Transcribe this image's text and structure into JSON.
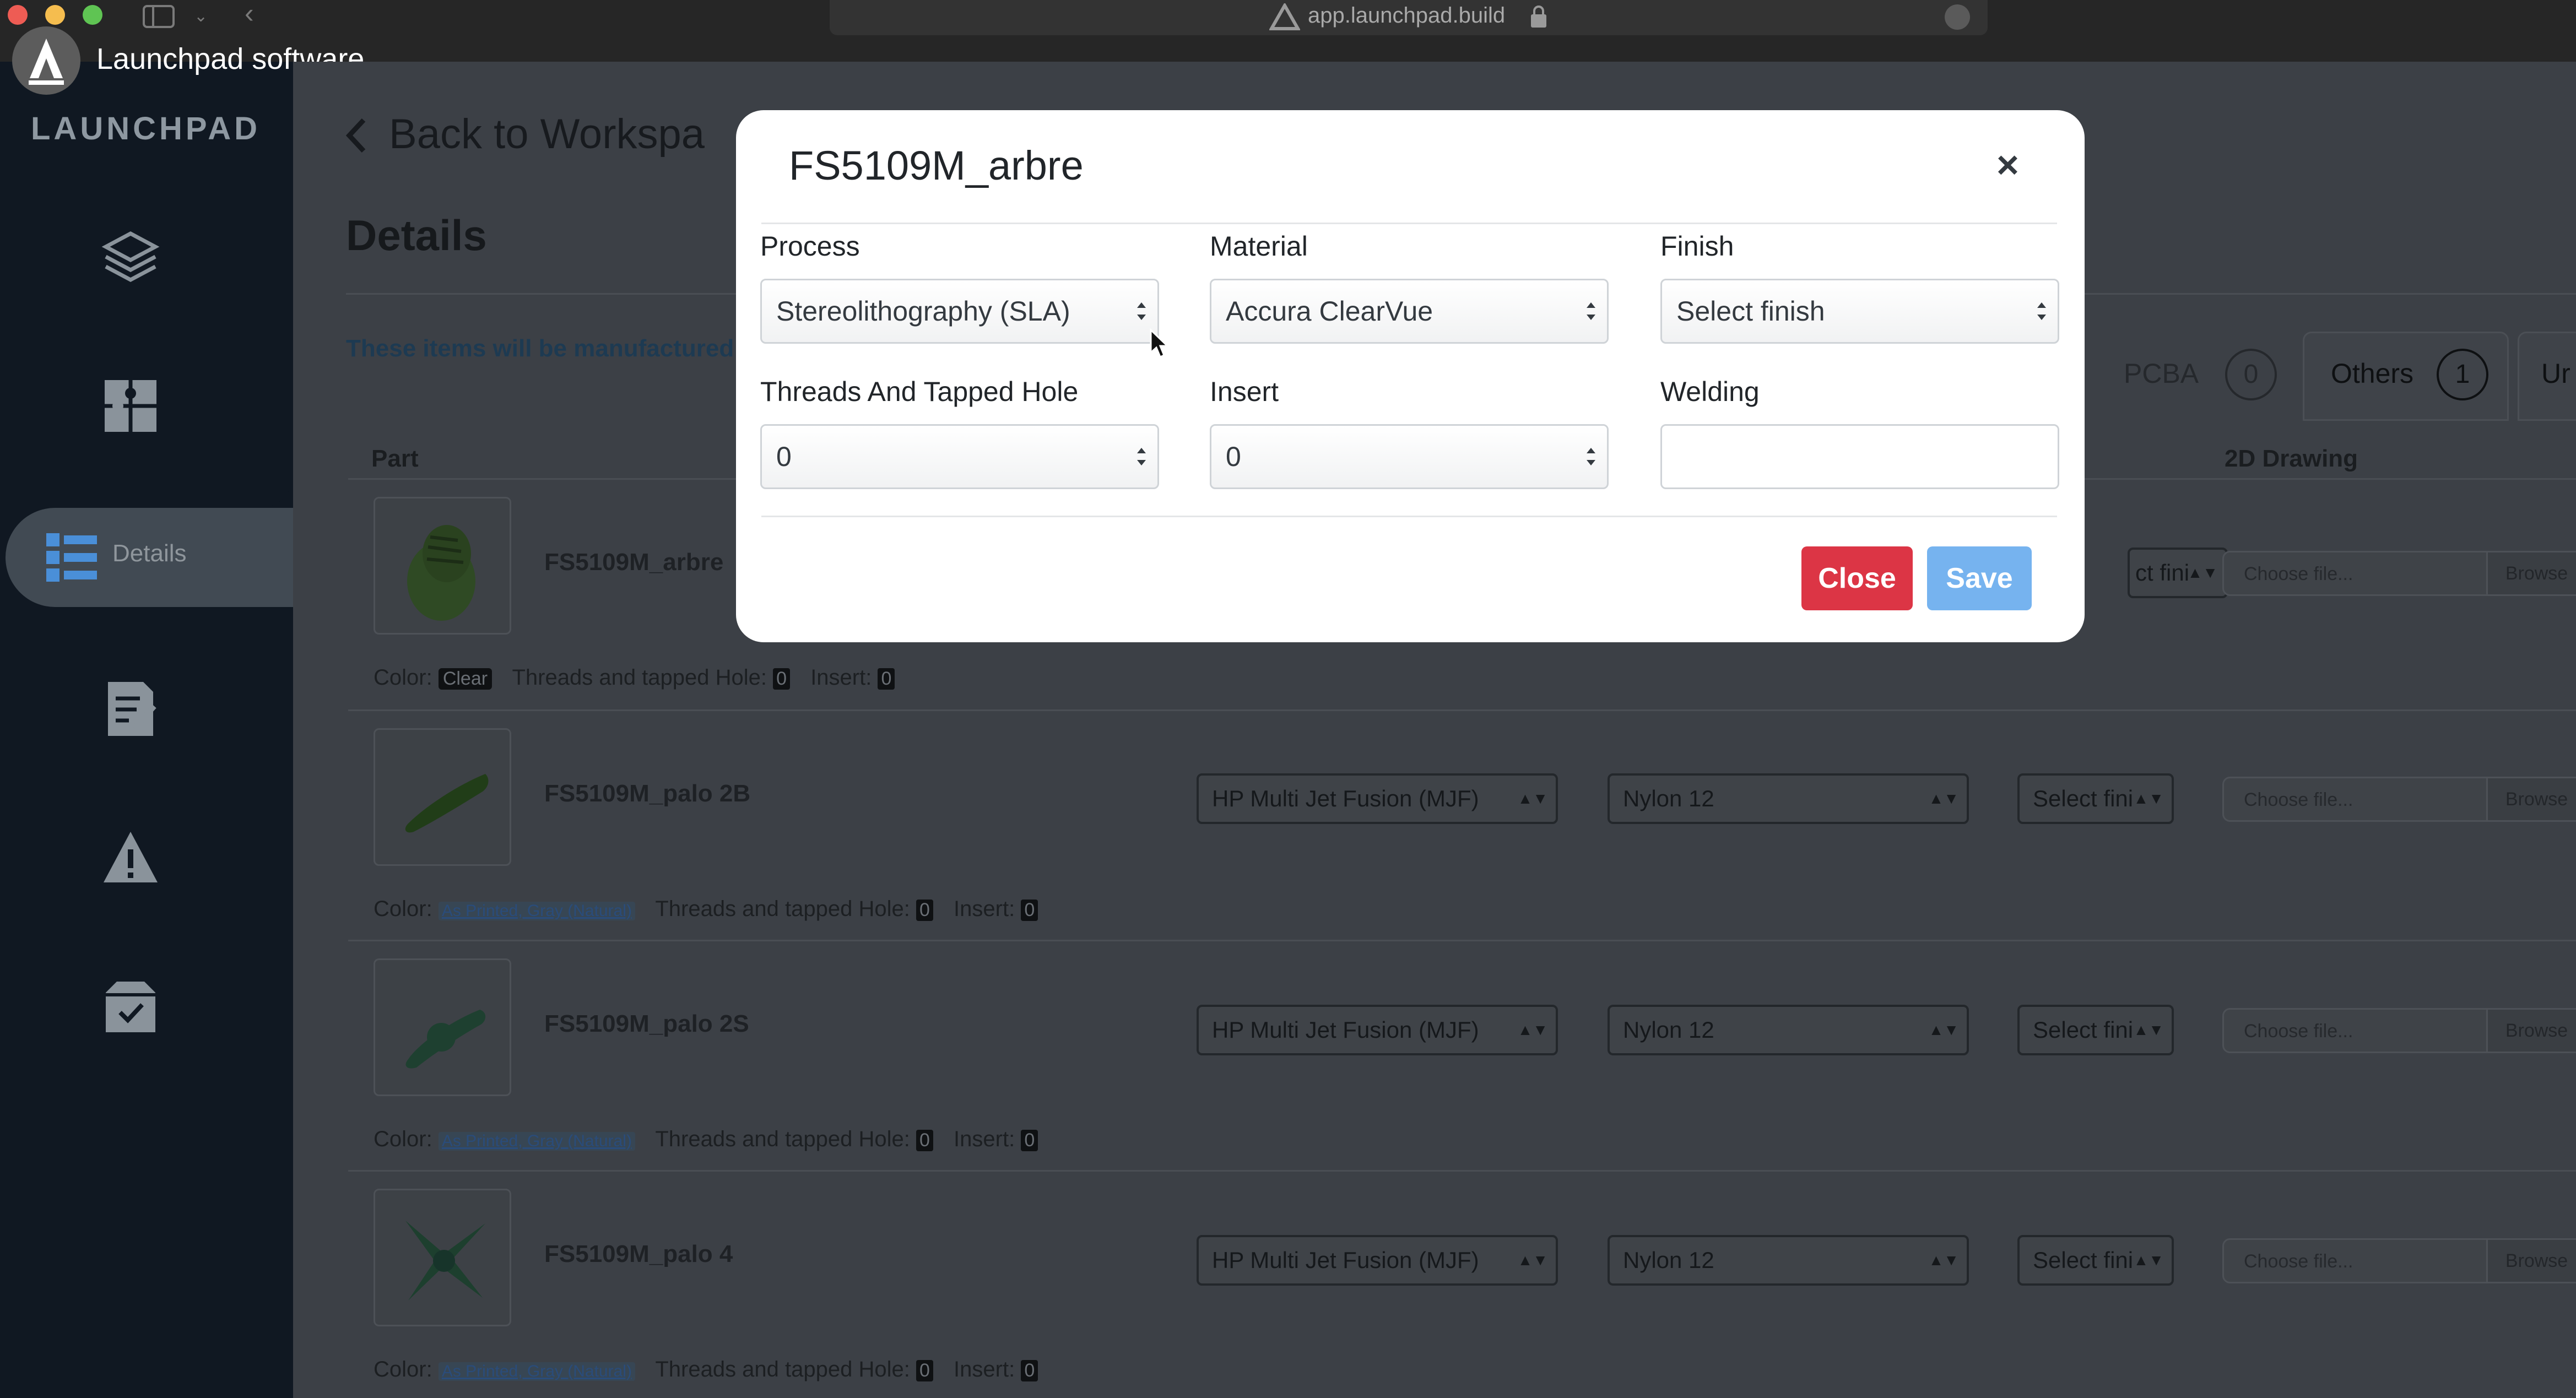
{
  "browser": {
    "url": "app.launchpad.build"
  },
  "overlay": {
    "title": "Launchpad software"
  },
  "sidebar": {
    "logo": "LAUNCHPAD",
    "items": [
      {
        "icon": "layers-icon"
      },
      {
        "icon": "puzzle-icon"
      },
      {
        "icon": "list-icon",
        "label": "Details"
      },
      {
        "icon": "checklist-icon"
      },
      {
        "icon": "warning-icon"
      },
      {
        "icon": "box-check-icon"
      }
    ]
  },
  "page": {
    "back": "Back to Workspa",
    "title": "Details",
    "note": "These items will be manufactured",
    "col_part": "Part",
    "col_drawing": "2D Drawing",
    "tabs": [
      {
        "label": "PCBA",
        "count": "0"
      },
      {
        "label": "Others",
        "count": "1"
      },
      {
        "label": "Ur"
      }
    ],
    "file_placeholder": "Choose file...",
    "browse": "Browse",
    "rows": [
      {
        "name": "FS5109M_arbre",
        "color_label": "Color:",
        "color": "Clear",
        "threads_label": "Threads and tapped Hole:",
        "threads": "0",
        "insert_label": "Insert:",
        "insert": "0",
        "finish": "ct fini"
      },
      {
        "name": "FS5109M_palo 2B",
        "color_label": "Color:",
        "color": "As Printed, Gray (Natural)",
        "threads_label": "Threads and tapped Hole:",
        "threads": "0",
        "insert_label": "Insert:",
        "insert": "0",
        "process": "HP Multi Jet Fusion (MJF)",
        "material": "Nylon 12",
        "finish": "Select fini"
      },
      {
        "name": "FS5109M_palo 2S",
        "color_label": "Color:",
        "color": "As Printed, Gray (Natural)",
        "threads_label": "Threads and tapped Hole:",
        "threads": "0",
        "insert_label": "Insert:",
        "insert": "0",
        "process": "HP Multi Jet Fusion (MJF)",
        "material": "Nylon 12",
        "finish": "Select fini"
      },
      {
        "name": "FS5109M_palo 4",
        "color_label": "Color:",
        "color": "As Printed, Gray (Natural)",
        "threads_label": "Threads and tapped Hole:",
        "threads": "0",
        "insert_label": "Insert:",
        "insert": "0",
        "process": "HP Multi Jet Fusion (MJF)",
        "material": "Nylon 12",
        "finish": "Select fini"
      }
    ]
  },
  "modal": {
    "title": "FS5109M_arbre",
    "close_icon": "×",
    "fields": {
      "process_label": "Process",
      "process_value": "Stereolithography (SLA)",
      "material_label": "Material",
      "material_value": "Accura ClearVue",
      "finish_label": "Finish",
      "finish_value": "Select finish",
      "threads_label": "Threads And Tapped Hole",
      "threads_value": "0",
      "insert_label": "Insert",
      "insert_value": "0",
      "welding_label": "Welding",
      "welding_value": ""
    },
    "close_button": "Close",
    "save_button": "Save"
  },
  "colors": {
    "close_button": "#dc3545",
    "save_button": "#76b3ef",
    "note": "#1d3a52"
  }
}
